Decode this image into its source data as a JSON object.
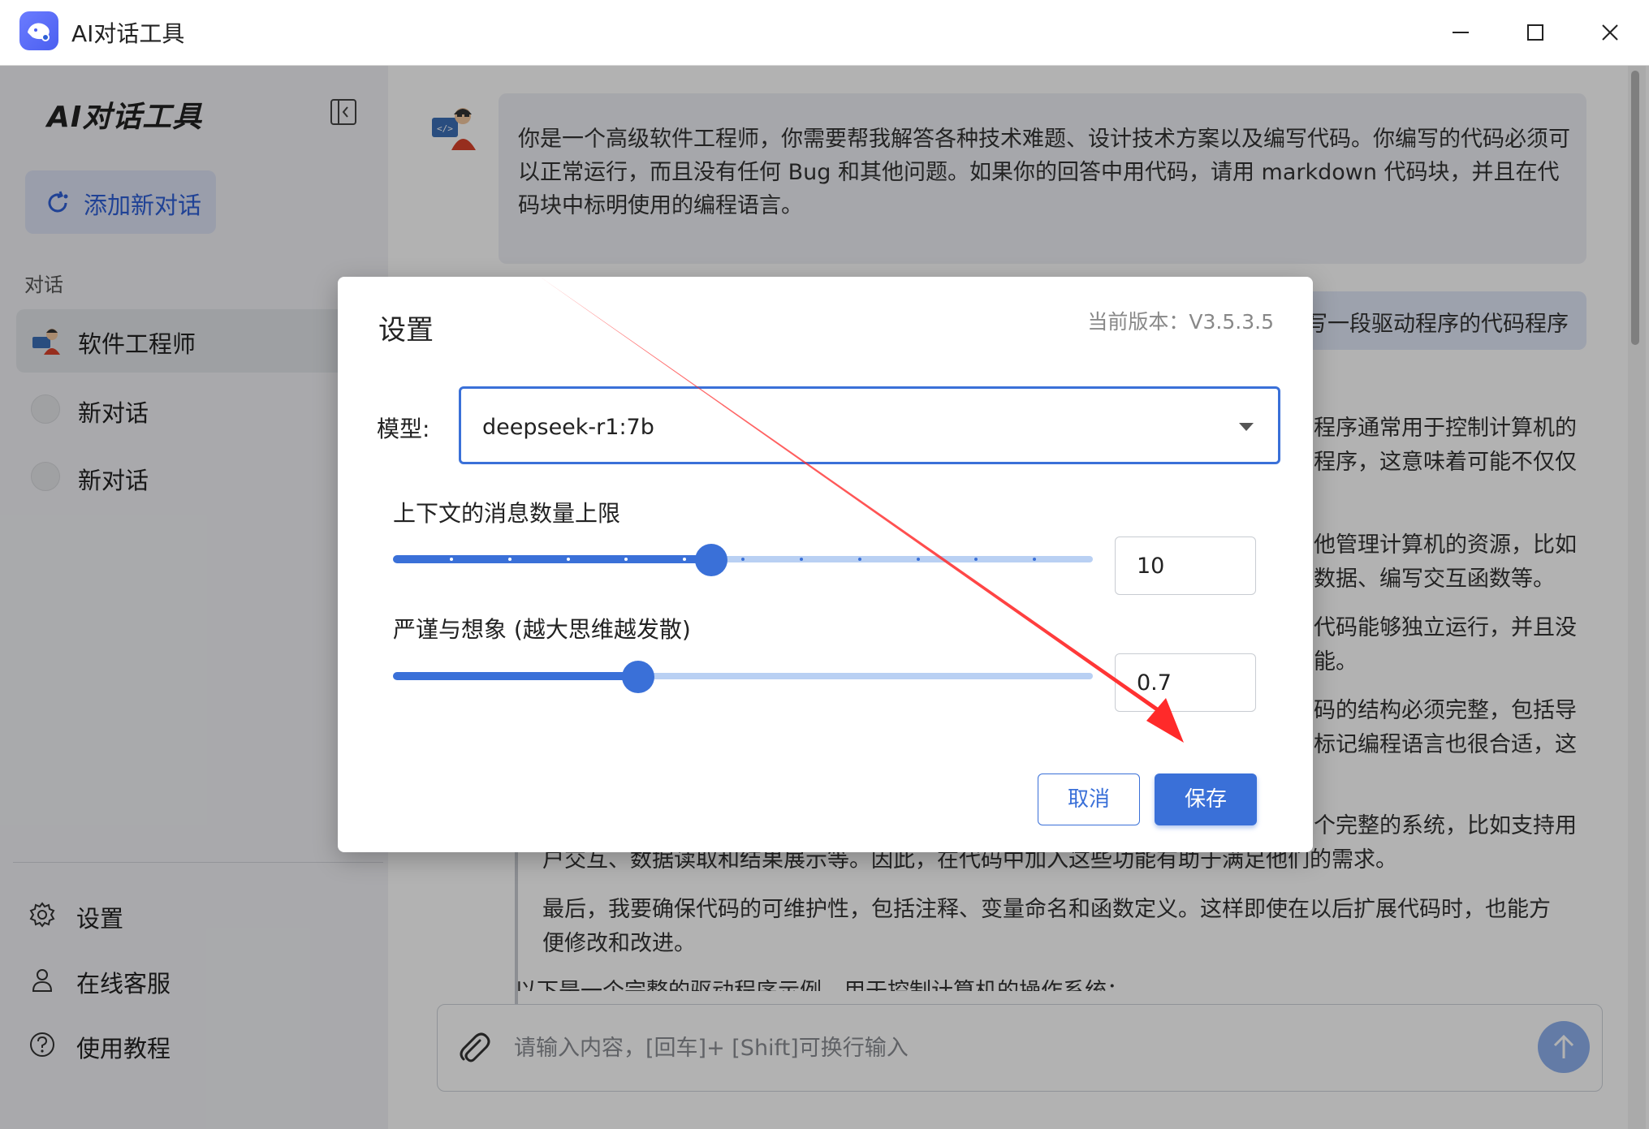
{
  "window": {
    "title": "AI对话工具"
  },
  "sidebar": {
    "brand": "AI对话工具",
    "new_chat_label": "添加新对话",
    "section_label": "对话",
    "conversations": [
      {
        "label": "软件工程师",
        "icon": "engineer-avatar-icon",
        "active": true
      },
      {
        "label": "新对话",
        "icon": "chat-bubble-icon",
        "active": false
      },
      {
        "label": "新对话",
        "icon": "chat-bubble-icon",
        "active": false
      }
    ],
    "bottom": [
      {
        "label": "设置",
        "icon": "gear-icon"
      },
      {
        "label": "在线客服",
        "icon": "user-icon"
      },
      {
        "label": "使用教程",
        "icon": "help-icon"
      }
    ]
  },
  "chat": {
    "system_prompt": "你是一个高级软件工程师，你需要帮我解答各种技术难题、设计技术方案以及编写代码。你编写的代码必须可以正常运行，而且没有任何 Bug 和其他问题。如果你的回答中用代码，请用 markdown 代码块，并且在代码块中标明使用的编程语言。",
    "user_message_fragment": "写一段驱动程序的代码程序",
    "reply_fragments": [
      "程序通常用于控制计算机的",
      "程序，这意味着可能不仅仅",
      "他管理计算机的资源，比如",
      "数据、编写交互函数等。",
      "代码能够独立运行，并且没",
      "能。",
      "码的结构必须完整，包括导",
      "标记编程语言也很合适，这",
      "个完整的系统，比如支持用",
      "户交互、数据读取和结果展示等。因此，在代码中加入这些功能有助于满足他们的需求。",
      "最后，我要确保代码的可维护性，包括注释、变量命名和函数定义。这样即使在以后扩展代码时，也能方",
      "便修改和改进。",
      "以下是一个完整的驱动程序示例，用于控制计算机的操作系统："
    ],
    "input_placeholder": "请输入内容，[回车]+ [Shift]可换行输入"
  },
  "settings_dialog": {
    "title": "设置",
    "version": "当前版本：V3.5.3.5",
    "model_label": "模型:",
    "model_value": "deepseek-r1:7b",
    "context_label": "上下文的消息数量上限",
    "context_value": "10",
    "context_min": 0,
    "context_max": 22,
    "context_ticks": 11,
    "temperature_label": "严谨与想象 (越大思维越发散)",
    "temperature_value": "0.7",
    "temperature_min": 0,
    "temperature_max": 2,
    "cancel_label": "取消",
    "save_label": "保存"
  },
  "colors": {
    "accent": "#3a70d8",
    "annotation_arrow": "#ff2a2a"
  }
}
